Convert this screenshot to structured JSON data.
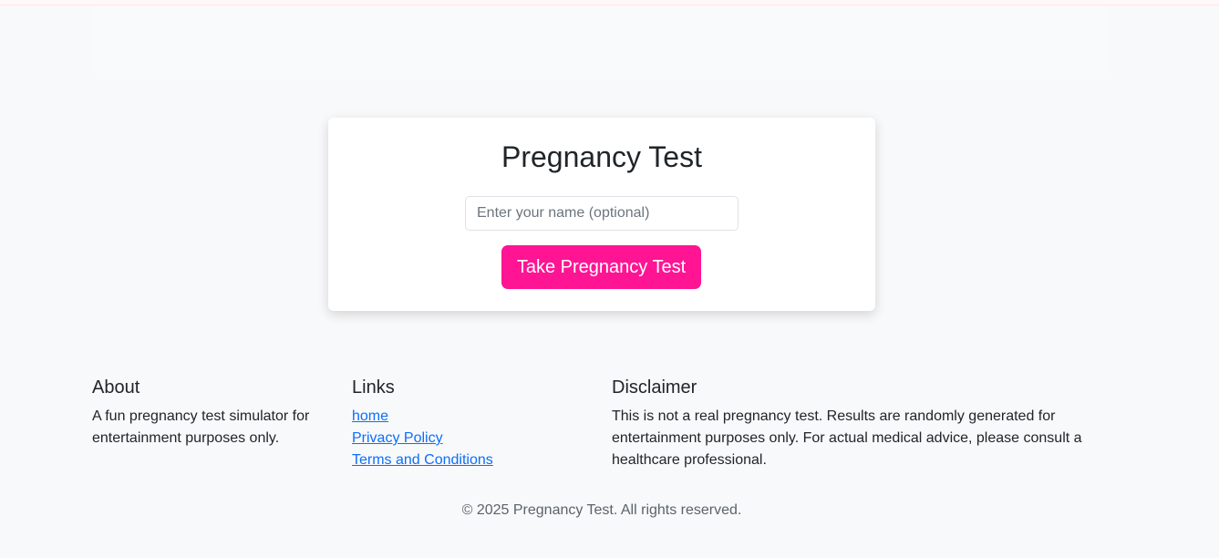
{
  "card": {
    "title": "Pregnancy Test",
    "name_placeholder": "Enter your name (optional)",
    "button_label": "Take Pregnancy Test"
  },
  "footer": {
    "about": {
      "heading": "About",
      "text": "A fun pregnancy test simulator for entertainment purposes only."
    },
    "links": {
      "heading": "Links",
      "items": [
        {
          "label": "home"
        },
        {
          "label": "Privacy Policy"
        },
        {
          "label": "Terms and Conditions"
        }
      ]
    },
    "disclaimer": {
      "heading": "Disclaimer",
      "text": "This is not a real pregnancy test. Results are randomly generated for entertainment purposes only. For actual medical advice, please consult a healthcare professional."
    },
    "copyright": "© 2025 Pregnancy Test. All rights reserved."
  },
  "colors": {
    "accent": "#ff1493",
    "link": "#0d6efd",
    "background": "#f8f9fa"
  }
}
